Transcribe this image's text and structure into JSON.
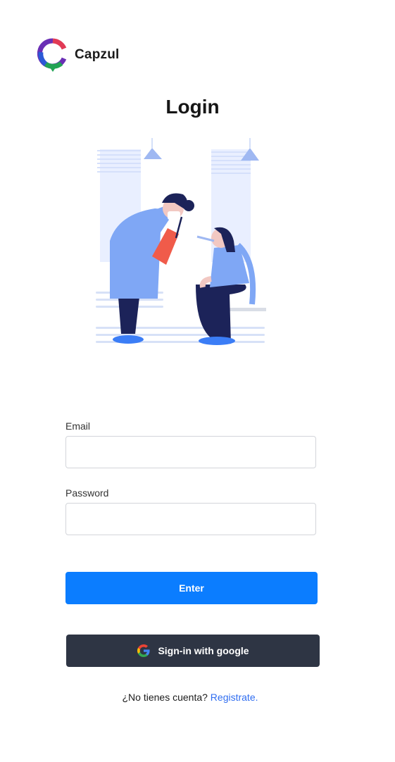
{
  "brand": {
    "name": "Capzul",
    "logo_icon": "capzul-logo-icon"
  },
  "page": {
    "title": "Login"
  },
  "illustration": {
    "icon": "doctor-patient-illustration"
  },
  "form": {
    "email_label": "Email",
    "email_value": "",
    "password_label": "Password",
    "password_value": "",
    "enter_label": "Enter"
  },
  "google": {
    "label": "Sign-in with google",
    "icon": "google-icon"
  },
  "footer": {
    "prompt": "¿No tienes cuenta?",
    "link": "Registrate."
  },
  "colors": {
    "primary": "#0b7dff",
    "google_button": "#2e3544",
    "link": "#2f6df0"
  }
}
